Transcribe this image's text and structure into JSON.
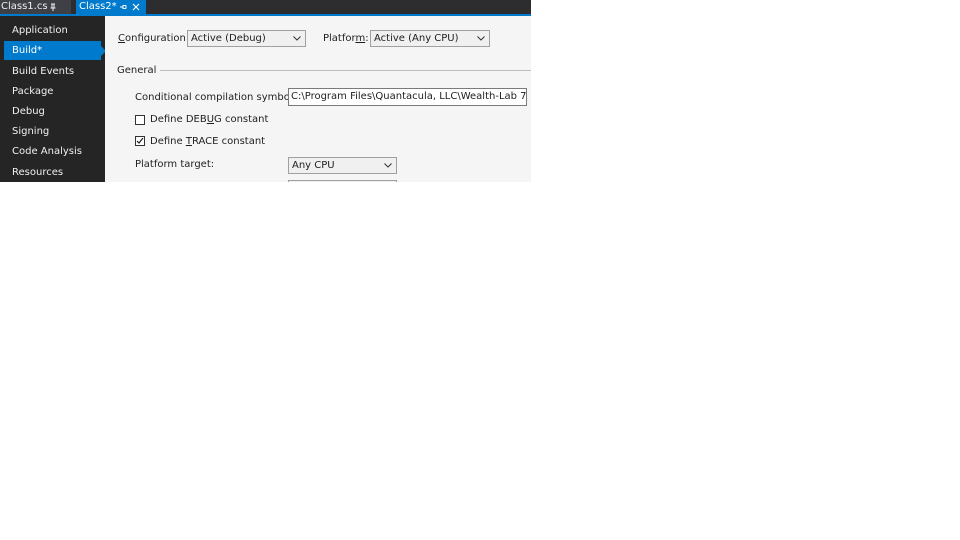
{
  "tabs": [
    {
      "label": "Class1.cs",
      "pinned": true,
      "active": false
    },
    {
      "label": "Class2*",
      "pinned": true,
      "active": true
    }
  ],
  "sidebar": {
    "items": [
      {
        "label": "Application"
      },
      {
        "label": "Build*"
      },
      {
        "label": "Build Events"
      },
      {
        "label": "Package"
      },
      {
        "label": "Debug"
      },
      {
        "label": "Signing"
      },
      {
        "label": "Code Analysis"
      },
      {
        "label": "Resources"
      }
    ],
    "active_index": 1
  },
  "config": {
    "configuration_label_pre": "",
    "configuration_label_u": "C",
    "configuration_label_post": "onfiguration:",
    "configuration_value": "Active (Debug)",
    "platform_label_pre": "Platfor",
    "platform_label_u": "m",
    "platform_label_post": ":",
    "platform_value": "Active (Any CPU)"
  },
  "general": {
    "section_title": "General",
    "symbols_label": "Conditional compilation symbols:",
    "symbols_value": "C:\\Program Files\\Quantacula, LLC\\Wealth-Lab 7",
    "debug_pre": "Define DEB",
    "debug_u": "U",
    "debug_post": "G constant",
    "debug_checked": false,
    "trace_pre": "Define ",
    "trace_u": "T",
    "trace_post": "RACE constant",
    "trace_checked": true,
    "platform_target_label": "Platform target:",
    "platform_target_value": "Any CPU"
  },
  "colors": {
    "accent": "#007acc",
    "sidebar_bg": "#252526",
    "tabstrip_bg": "#2d2d30",
    "content_bg": "#f5f5f5"
  }
}
